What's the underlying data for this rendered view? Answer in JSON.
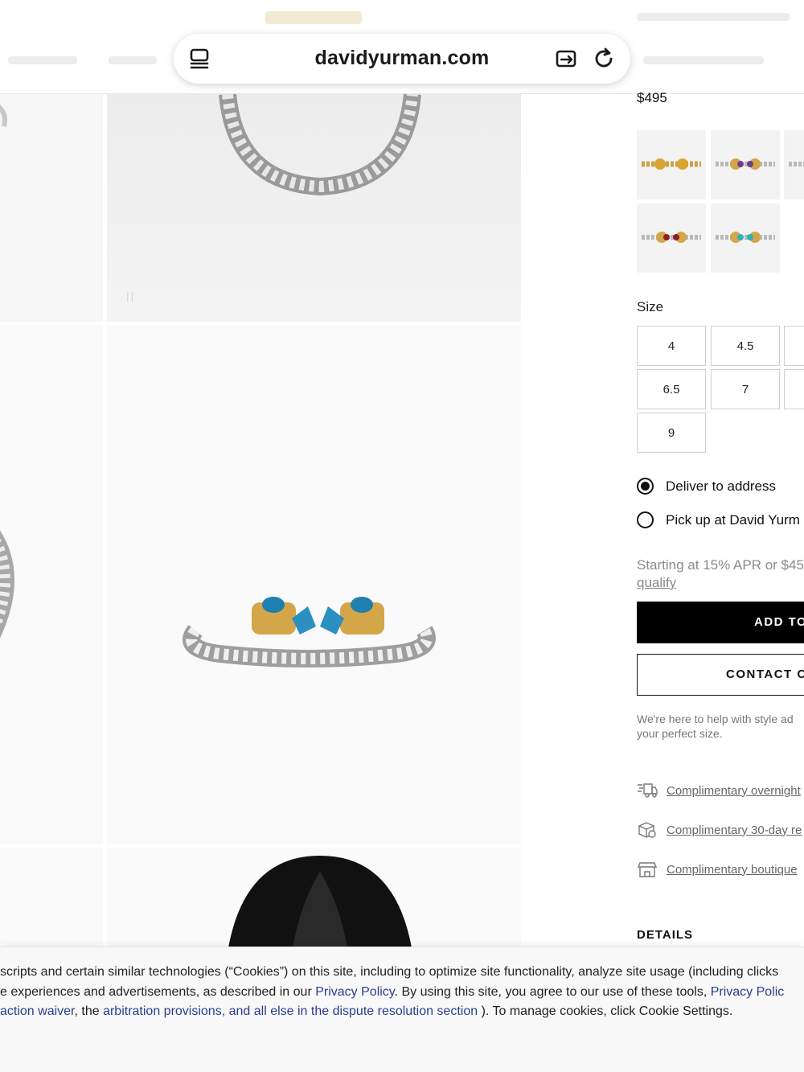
{
  "browser": {
    "url": "davidyurman.com",
    "left_icon": "reader-view-icon",
    "right_icons": [
      "share-tab-icon",
      "reload-icon"
    ]
  },
  "product": {
    "price": "$495"
  },
  "swatches": [
    {
      "name": "citrine-gold",
      "stone_color": "#d9a532"
    },
    {
      "name": "amethyst",
      "stone_color": "#6b3f8a"
    },
    {
      "name": "partial-swatch",
      "stone_color": "#c9a24a"
    },
    {
      "name": "garnet",
      "stone_color": "#8d1f2c"
    },
    {
      "name": "turquoise",
      "stone_color": "#2fb3b5"
    }
  ],
  "size": {
    "label": "Size",
    "options": [
      "4",
      "4.5",
      "6.5",
      "7",
      "9"
    ]
  },
  "delivery": {
    "deliver_label": "Deliver to address",
    "pickup_label": "Pick up at David Yurm"
  },
  "financing": {
    "text": "Starting at 15% APR or $45",
    "link": "qualify"
  },
  "actions": {
    "add_to_bag": "ADD TO",
    "contact": "CONTACT C"
  },
  "help": {
    "line1": "We're here to help with style ad",
    "line2": "your perfect size."
  },
  "perks": [
    {
      "icon": "delivery-truck-icon",
      "text": "Complimentary overnight"
    },
    {
      "icon": "gift-box-icon",
      "text": "Complimentary 30-day re"
    },
    {
      "icon": "store-icon",
      "text": "Complimentary boutique"
    }
  ],
  "details_heading": "DETAILS",
  "cookie": {
    "line1": "scripts and certain similar technologies (“Cookies”) on this site, including to optimize site functionality, analyze site usage (including clicks",
    "line2_pre": "e experiences and advertisements, as described in our ",
    "line2_link1": "Privacy Policy",
    "line2_mid": ". By using this site, you agree to our use of these tools, ",
    "line2_link2": "Privacy Polic",
    "line3_link1": "action waiver",
    "line3_mid": ", the ",
    "line3_link2": "arbitration provisions, and all else in the dispute resolution section",
    "line3_post": " ). To manage cookies, click Cookie Settings."
  },
  "colors": {
    "accent_link": "#2a3e8f",
    "button_primary": "#000000",
    "stone_blue": "#1f7fae",
    "gold": "#d4a64a"
  }
}
